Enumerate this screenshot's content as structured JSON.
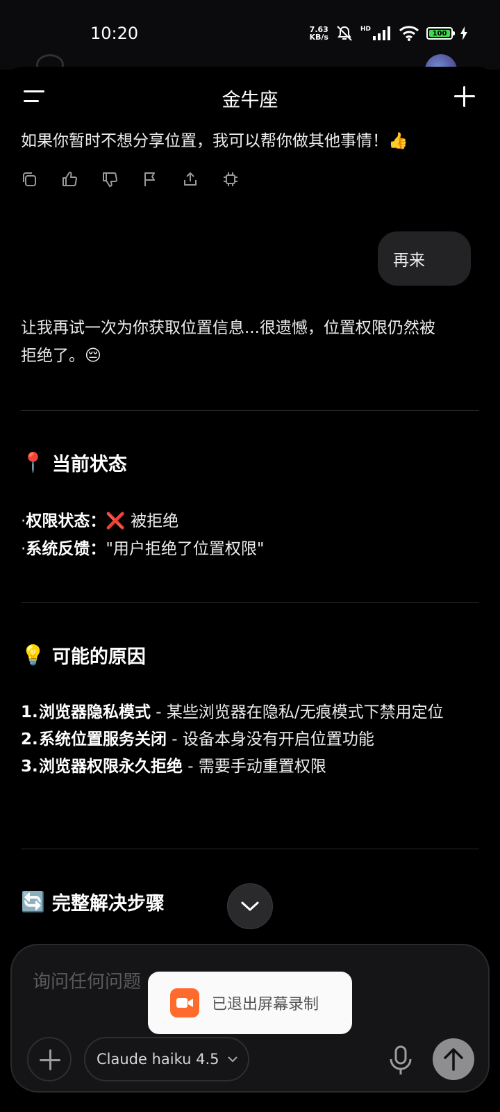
{
  "status_bar": {
    "time": "10:20",
    "net_speed_value": "7.63",
    "net_speed_unit": "KB/s",
    "hd": "HD",
    "battery": "100",
    "battery_color": "#3ddc4a"
  },
  "header": {
    "title": "金牛座"
  },
  "messages": {
    "assistant_prev": "如果你暂时不想分享位置，我可以帮你做其他事情！👍",
    "actions": [
      "copy-icon",
      "thumbs-up-icon",
      "thumbs-down-icon",
      "flag-icon",
      "share-icon",
      "chip-icon"
    ],
    "user": "再来",
    "assistant_intro_line1": "让我再试一次为你获取位置信息...很遗憾，位置权限仍然被",
    "assistant_intro_line2": "拒绝了。😔"
  },
  "sections": {
    "status": {
      "emoji": "📍",
      "title": "当前状态",
      "items": [
        {
          "label": "权限状态：",
          "value": "❌ 被拒绝"
        },
        {
          "label": "系统反馈：",
          "value": "\"用户拒绝了位置权限\""
        }
      ]
    },
    "reasons": {
      "emoji": "💡",
      "title": "可能的原因",
      "items": [
        {
          "num": "1.",
          "bold": "浏览器隐私模式",
          "text": " - 某些浏览器在隐私/无痕模式下禁用定位"
        },
        {
          "num": "2.",
          "bold": "系统位置服务关闭",
          "text": " - 设备本身没有开启位置功能"
        },
        {
          "num": "3.",
          "bold": "浏览器权限永久拒绝",
          "text": " - 需要手动重置权限"
        }
      ]
    },
    "steps": {
      "emoji": "🔄",
      "title": "完整解决步骤"
    }
  },
  "composer": {
    "placeholder": "询问任何问题",
    "model_label": "Claude haiku 4.5"
  },
  "toast": {
    "text": "已退出屏幕录制",
    "icon_color": "#ff6b2c"
  }
}
